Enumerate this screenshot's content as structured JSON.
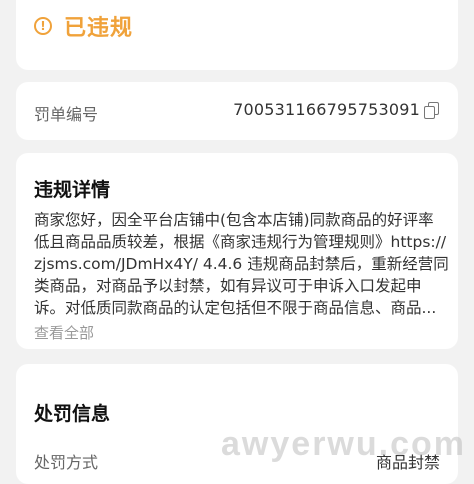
{
  "status": {
    "icon": "warning-circle-icon",
    "icon_glyph": "!",
    "text": "已违规",
    "color": "#f0a23a"
  },
  "penalty": {
    "label": "罚单编号",
    "value": "700531166795753091",
    "copy_icon": "copy-icon"
  },
  "details": {
    "title": "违规详情",
    "lines": [
      "商家您好，因全平台店铺中(包含本店铺)同款商品的好评率",
      "低且商品品质较差，根据《商家违规行为管理规则》https://",
      "zjsms.com/JDmHx4Y/ 4.4.6 违规商品封禁后，重新经营同",
      "类商品，对商品予以封禁，如有异议可于申诉入口发起申",
      "诉。对低质同款商品的认定包括但不限于商品信息、商品..."
    ],
    "view_all": "查看全部"
  },
  "punish": {
    "title": "处罚信息",
    "method_label": "处罚方式",
    "method_value": "商品封禁"
  },
  "watermark": {
    "text": "awyerwu.com"
  }
}
